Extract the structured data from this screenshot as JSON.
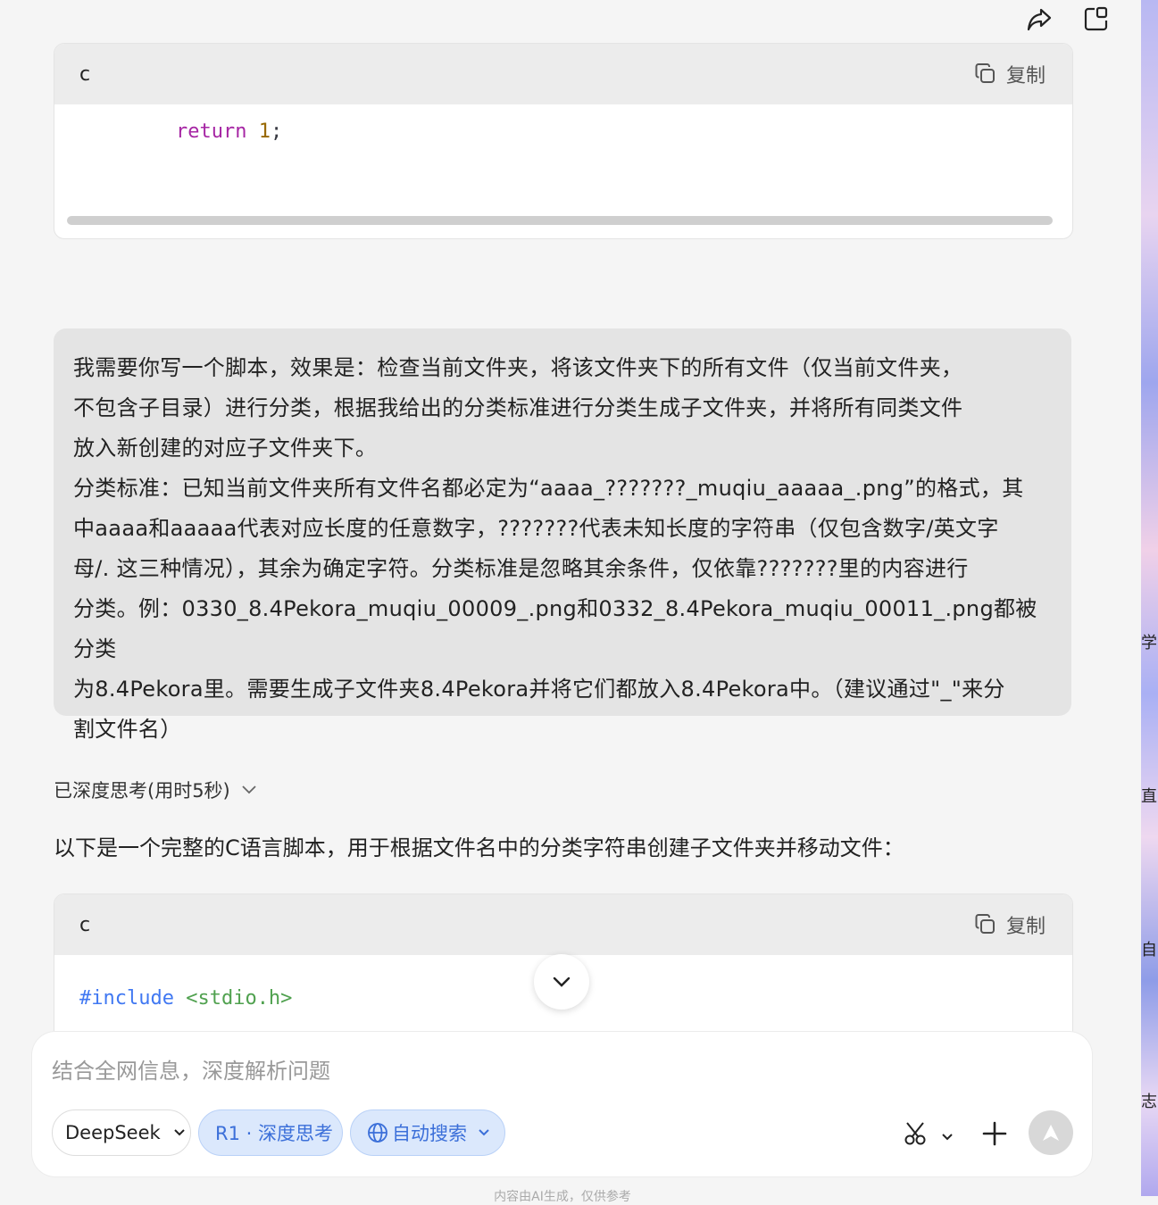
{
  "top_actions": {
    "share_icon": "share-icon",
    "new_chat_icon": "new-chat-icon"
  },
  "code_block_1": {
    "lang": "c",
    "copy_label": "复制",
    "kw": "return",
    "num": "1",
    "pun": ";"
  },
  "user_message": {
    "lines": [
      "我需要你写一个脚本，效果是：检查当前文件夹，将该文件夹下的所有文件（仅当前文件夹，",
      "不包含子目录）进行分类，根据我给出的分类标准进行分类生成子文件夹，并将所有同类文件",
      "放入新创建的对应子文件夹下。",
      "分类标准：已知当前文件夹所有文件名都必定为“aaaa_???????_muqiu_aaaaa_.png”的格式，其",
      "中aaaa和aaaaa代表对应长度的任意数字，???????代表未知长度的字符串（仅包含数字/英文字",
      "母/. 这三种情况），其余为确定字符。分类标准是忽略其余条件，仅依靠???????里的内容进行",
      "分类。例：0330_8.4Pekora_muqiu_00009_.png和0332_8.4Pekora_muqiu_00011_.png都被分类",
      "为8.4Pekora里。需要生成子文件夹8.4Pekora并将它们都放入8.4Pekora中。（建议通过\"_\"来分",
      "割文件名）"
    ]
  },
  "thinking": {
    "label": "已深度思考(用时5秒)"
  },
  "answer": {
    "intro": "以下是一个完整的C语言脚本，用于根据文件名中的分类字符串创建子文件夹并移动文件："
  },
  "code_block_2": {
    "lang": "c",
    "copy_label": "复制",
    "directive": "#include",
    "header": "<stdio.h>"
  },
  "composer": {
    "placeholder": "结合全网信息，深度解析问题",
    "model_label": "DeepSeek",
    "r1_label": "R1 · 深度思考",
    "search_label": "自动搜索"
  },
  "footnote": "内容由AI生成，仅供参考",
  "side_chars": [
    "学",
    "直",
    "自",
    "志"
  ]
}
